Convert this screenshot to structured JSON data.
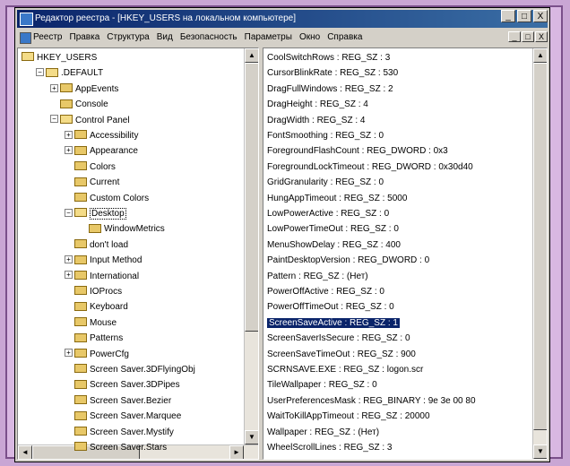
{
  "window": {
    "title": "Редактор реестра - [HKEY_USERS на локальном компьютере]",
    "min_btn": "_",
    "max_btn": "□",
    "close_btn": "X"
  },
  "menu": [
    "Реестр",
    "Правка",
    "Структура",
    "Вид",
    "Безопасность",
    "Параметры",
    "Окно",
    "Справка"
  ],
  "tree": [
    {
      "label": "HKEY_USERS",
      "depth": 0,
      "expander": "",
      "open": true
    },
    {
      "label": ".DEFAULT",
      "depth": 1,
      "expander": "−",
      "open": true
    },
    {
      "label": "AppEvents",
      "depth": 2,
      "expander": "+",
      "open": false
    },
    {
      "label": "Console",
      "depth": 2,
      "expander": "",
      "open": false
    },
    {
      "label": "Control Panel",
      "depth": 2,
      "expander": "−",
      "open": true
    },
    {
      "label": "Accessibility",
      "depth": 3,
      "expander": "+",
      "open": false
    },
    {
      "label": "Appearance",
      "depth": 3,
      "expander": "+",
      "open": false
    },
    {
      "label": "Colors",
      "depth": 3,
      "expander": "",
      "open": false
    },
    {
      "label": "Current",
      "depth": 3,
      "expander": "",
      "open": false
    },
    {
      "label": "Custom Colors",
      "depth": 3,
      "expander": "",
      "open": false
    },
    {
      "label": "Desktop",
      "depth": 3,
      "expander": "−",
      "open": true,
      "selected": true
    },
    {
      "label": "WindowMetrics",
      "depth": 4,
      "expander": "",
      "open": false
    },
    {
      "label": "don't load",
      "depth": 3,
      "expander": "",
      "open": false
    },
    {
      "label": "Input Method",
      "depth": 3,
      "expander": "+",
      "open": false
    },
    {
      "label": "International",
      "depth": 3,
      "expander": "+",
      "open": false
    },
    {
      "label": "IOProcs",
      "depth": 3,
      "expander": "",
      "open": false
    },
    {
      "label": "Keyboard",
      "depth": 3,
      "expander": "",
      "open": false
    },
    {
      "label": "Mouse",
      "depth": 3,
      "expander": "",
      "open": false
    },
    {
      "label": "Patterns",
      "depth": 3,
      "expander": "",
      "open": false
    },
    {
      "label": "PowerCfg",
      "depth": 3,
      "expander": "+",
      "open": false
    },
    {
      "label": "Screen Saver.3DFlyingObj",
      "depth": 3,
      "expander": "",
      "open": false
    },
    {
      "label": "Screen Saver.3DPipes",
      "depth": 3,
      "expander": "",
      "open": false
    },
    {
      "label": "Screen Saver.Bezier",
      "depth": 3,
      "expander": "",
      "open": false
    },
    {
      "label": "Screen Saver.Marquee",
      "depth": 3,
      "expander": "",
      "open": false
    },
    {
      "label": "Screen Saver.Mystify",
      "depth": 3,
      "expander": "",
      "open": false
    },
    {
      "label": "Screen Saver.Stars",
      "depth": 3,
      "expander": "",
      "open": false
    }
  ],
  "values": [
    {
      "text": "CoolSwitchRows : REG_SZ : 3"
    },
    {
      "text": "CursorBlinkRate : REG_SZ : 530"
    },
    {
      "text": "DragFullWindows : REG_SZ : 2"
    },
    {
      "text": "DragHeight : REG_SZ : 4"
    },
    {
      "text": "DragWidth : REG_SZ : 4"
    },
    {
      "text": "FontSmoothing : REG_SZ : 0"
    },
    {
      "text": "ForegroundFlashCount : REG_DWORD : 0x3"
    },
    {
      "text": "ForegroundLockTimeout : REG_DWORD : 0x30d40"
    },
    {
      "text": "GridGranularity : REG_SZ : 0"
    },
    {
      "text": "HungAppTimeout : REG_SZ : 5000"
    },
    {
      "text": "LowPowerActive : REG_SZ : 0"
    },
    {
      "text": "LowPowerTimeOut : REG_SZ : 0"
    },
    {
      "text": "MenuShowDelay : REG_SZ : 400"
    },
    {
      "text": "PaintDesktopVersion : REG_DWORD : 0"
    },
    {
      "text": "Pattern : REG_SZ : (Нет)"
    },
    {
      "text": "PowerOffActive : REG_SZ : 0"
    },
    {
      "text": "PowerOffTimeOut : REG_SZ : 0"
    },
    {
      "text": "ScreenSaveActive : REG_SZ : 1",
      "selected": true
    },
    {
      "text": "ScreenSaverIsSecure : REG_SZ : 0"
    },
    {
      "text": "ScreenSaveTimeOut : REG_SZ : 900"
    },
    {
      "text": "SCRNSAVE.EXE : REG_SZ : logon.scr"
    },
    {
      "text": "TileWallpaper : REG_SZ : 0"
    },
    {
      "text": "UserPreferencesMask : REG_BINARY : 9e 3e 00 80"
    },
    {
      "text": "WaitToKillAppTimeout : REG_SZ : 20000"
    },
    {
      "text": "Wallpaper : REG_SZ : (Нет)"
    },
    {
      "text": "WheelScrollLines : REG_SZ : 3"
    }
  ],
  "scroll": {
    "up": "▲",
    "down": "▼",
    "left": "◄",
    "right": "►"
  }
}
